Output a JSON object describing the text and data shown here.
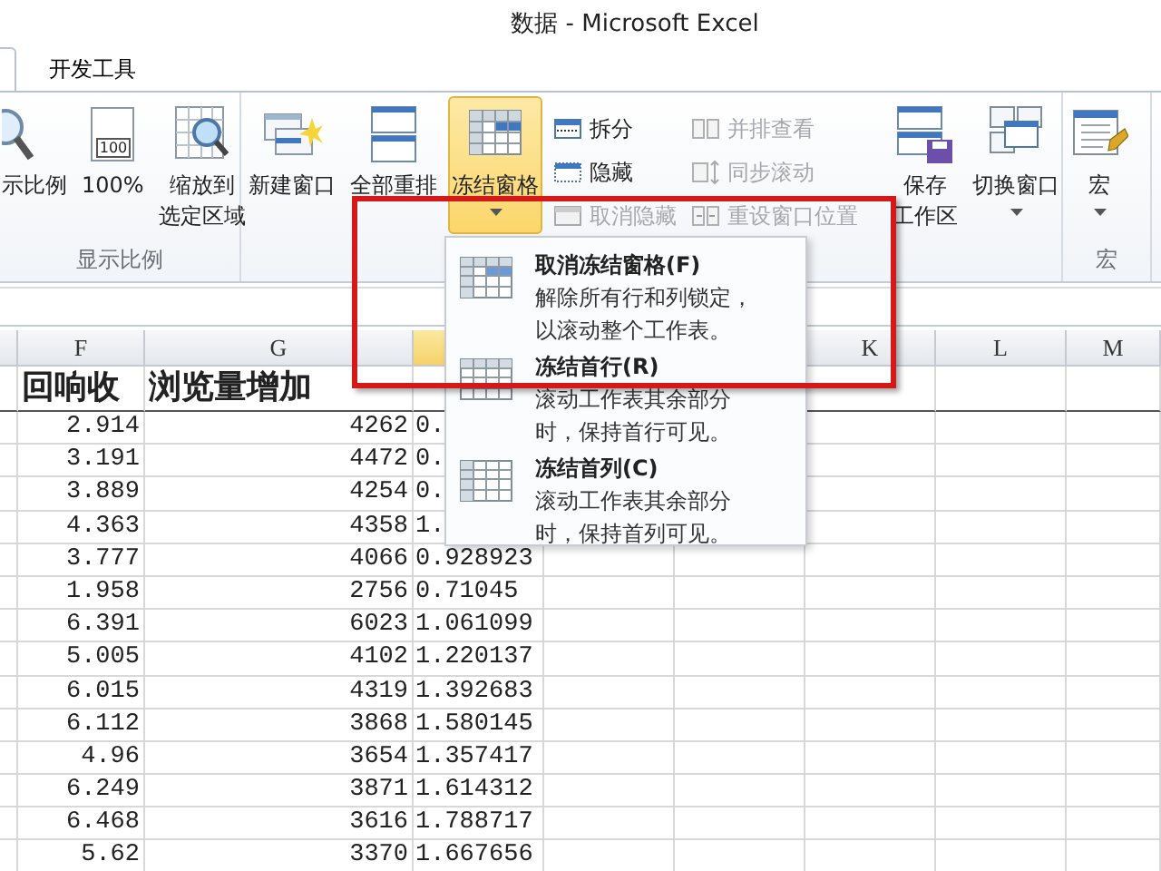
{
  "window": {
    "title": "数据 - Microsoft Excel"
  },
  "tabs": [
    {
      "label": "开发工具",
      "selected": false
    }
  ],
  "ribbon": {
    "groups": [
      {
        "label": "显示比例",
        "controls": [
          {
            "kind": "large",
            "lines": [
              "示比例"
            ]
          },
          {
            "kind": "large",
            "badge": "100",
            "lines": [
              "100%"
            ]
          },
          {
            "kind": "large",
            "lines": [
              "缩放到",
              "选定区域"
            ]
          }
        ]
      },
      {
        "controls": [
          {
            "kind": "large",
            "lines": [
              "新建窗口"
            ]
          },
          {
            "kind": "large",
            "lines": [
              "全部重排"
            ]
          },
          {
            "kind": "large",
            "lines": [
              "冻结窗格"
            ],
            "selected": true,
            "dropdown": true
          },
          {
            "kind": "stack",
            "items": [
              {
                "label": "拆分",
                "disabled": false
              },
              {
                "label": "隐藏",
                "disabled": false
              },
              {
                "label": "取消隐藏",
                "disabled": true
              }
            ]
          },
          {
            "kind": "stack",
            "items": [
              {
                "label": "并排查看",
                "disabled": true
              },
              {
                "label": "同步滚动",
                "disabled": true
              },
              {
                "label": "重设窗口位置",
                "disabled": true
              }
            ]
          },
          {
            "kind": "large",
            "lines": [
              "保存",
              "工作区"
            ]
          },
          {
            "kind": "large",
            "lines": [
              "切换窗口"
            ],
            "dropdown": true
          }
        ]
      },
      {
        "label": "宏",
        "controls": [
          {
            "kind": "large",
            "lines": [
              "宏"
            ],
            "dropdown": true
          }
        ]
      }
    ]
  },
  "sheet": {
    "columns": [
      {
        "letter": "F",
        "selected": false
      },
      {
        "letter": "G",
        "selected": false
      },
      {
        "selected": true
      }
    ],
    "columns_right": [
      {
        "letter": "K"
      },
      {
        "letter": "L"
      },
      {
        "letter": "M"
      }
    ],
    "header_row": [
      "回响收",
      "浏览量增加"
    ],
    "rows": [
      [
        "2.914",
        "4262",
        "0."
      ],
      [
        "3.191",
        "4472",
        "0."
      ],
      [
        "3.889",
        "4254",
        "0."
      ],
      [
        "4.363",
        "4358",
        "1."
      ],
      [
        "3.777",
        "4066",
        "0.928923"
      ],
      [
        "1.958",
        "2756",
        "0.71045"
      ],
      [
        "6.391",
        "6023",
        "1.061099"
      ],
      [
        "5.005",
        "4102",
        "1.220137"
      ],
      [
        "6.015",
        "4319",
        "1.392683"
      ],
      [
        "6.112",
        "3868",
        "1.580145"
      ],
      [
        "4.96",
        "3654",
        "1.357417"
      ],
      [
        "6.249",
        "3871",
        "1.614312"
      ],
      [
        "6.468",
        "3616",
        "1.788717"
      ],
      [
        "5.62",
        "3370",
        "1.667656"
      ]
    ]
  },
  "freeze_menu": {
    "items": [
      {
        "title": "取消冻结窗格(F)",
        "description": "解除所有行和列锁定，以滚动整个工作表。"
      },
      {
        "title": "冻结首行(R)",
        "description": "滚动工作表其余部分时，保持首行可见。"
      },
      {
        "title": "冻结首列(C)",
        "description": "滚动工作表其余部分时，保持首列可见。"
      }
    ]
  }
}
